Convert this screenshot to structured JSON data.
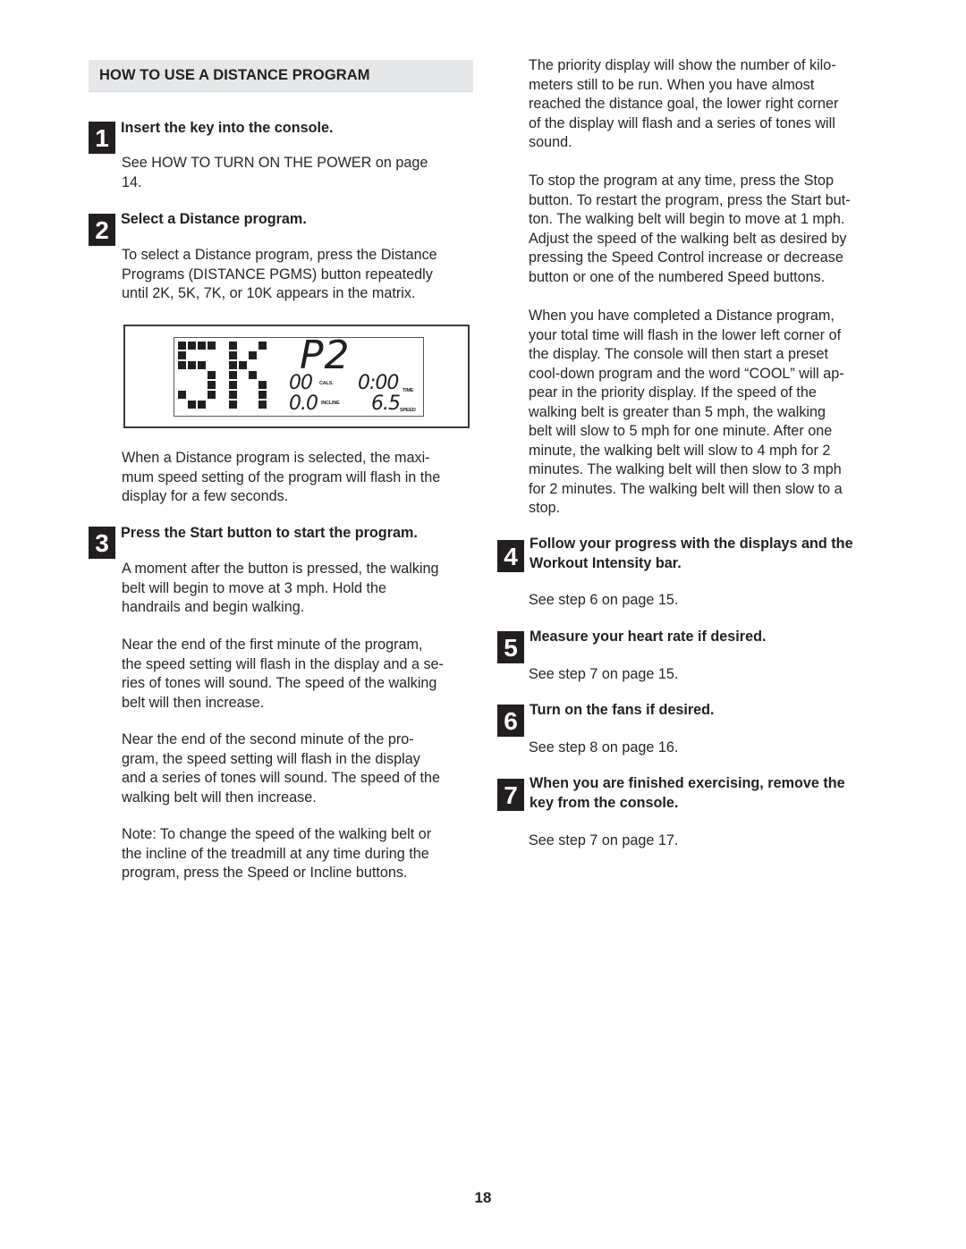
{
  "section": {
    "title": "HOW TO USE A DISTANCE PROGRAM"
  },
  "left_steps": [
    {
      "number": "1",
      "title": "Insert the key into the console.",
      "paragraphs": [
        "See HOW TO TURN ON THE POWER on page\n14."
      ]
    },
    {
      "number": "2",
      "title": "Select a Distance program.",
      "paragraphs": [
        "To select a Distance program, press the Distance\nPrograms (DISTANCE PGMS) button repeatedly\nuntil 2K, 5K, 7K, or 10K appears in the matrix.",
        "When a Distance program is selected, the maxi-\nmum speed setting of the program will flash in the\ndisplay for a few seconds."
      ]
    },
    {
      "number": "3",
      "title": "Press the Start button to start the program.",
      "paragraphs": [
        "A moment after the button is pressed, the walking\nbelt will begin to move at 3 mph. Hold the\nhandrails and begin walking.",
        "Near the end of the first minute of the program,\nthe speed setting will flash in the display and a se-\nries of tones will sound. The speed of the walking\nbelt will then increase.",
        "Near the end of the second minute of the pro-\ngram, the speed setting will flash in the display\nand a series of tones will sound. The speed of the\nwalking belt will then increase.",
        "Note: To change the speed of the walking belt or\nthe incline of the treadmill at any time during the\nprogram, press the Speed or Incline buttons."
      ]
    }
  ],
  "console_display": {
    "matrix_text": "5K",
    "program": "P2",
    "cals_value": "00",
    "cals_label": "CALS.",
    "time_value": "0:00",
    "time_label": "TIME",
    "incline_value": "0.0",
    "incline_label": "INCLINE",
    "speed_value": "6.5",
    "speed_label": "SPEED"
  },
  "right_column": {
    "paragraphs": [
      "The priority display will show the number of kilo-\nmeters still to be run. When you have almost\nreached the distance goal, the lower right corner\nof the display will flash and a series of tones will\nsound.",
      "To stop the program at any time, press the Stop\nbutton. To restart the program, press the Start but-\nton. The walking belt will begin to move at 1 mph.\nAdjust the speed of the walking belt as desired by\npressing the Speed Control increase or decrease\nbutton or one of the numbered Speed buttons.",
      "When you have completed a Distance program,\nyour total time will flash in the lower left corner of\nthe display. The console will then start a preset\ncool-down program and the word “COOL” will ap-\npear in the priority display. If the speed of the\nwalking belt is greater than 5 mph, the walking\nbelt will slow to 5 mph for one minute. After one\nminute, the walking belt will slow to 4 mph for 2\nminutes. The walking belt will then slow to 3 mph\nfor 2 minutes. The walking belt will then slow to a\nstop."
    ],
    "steps": [
      {
        "number": "4",
        "title": "Follow your progress with the displays and the\nWorkout Intensity bar.",
        "text": "See step 6 on page 15."
      },
      {
        "number": "5",
        "title": "Measure your heart rate if desired.",
        "text": "See step 7 on page 15."
      },
      {
        "number": "6",
        "title": "Turn on the fans if desired.",
        "text": "See step 8 on page 16."
      },
      {
        "number": "7",
        "title": "When you are finished exercising, remove the\nkey from the console.",
        "text": "See step 7 on page 17."
      }
    ]
  },
  "page_number": "18"
}
